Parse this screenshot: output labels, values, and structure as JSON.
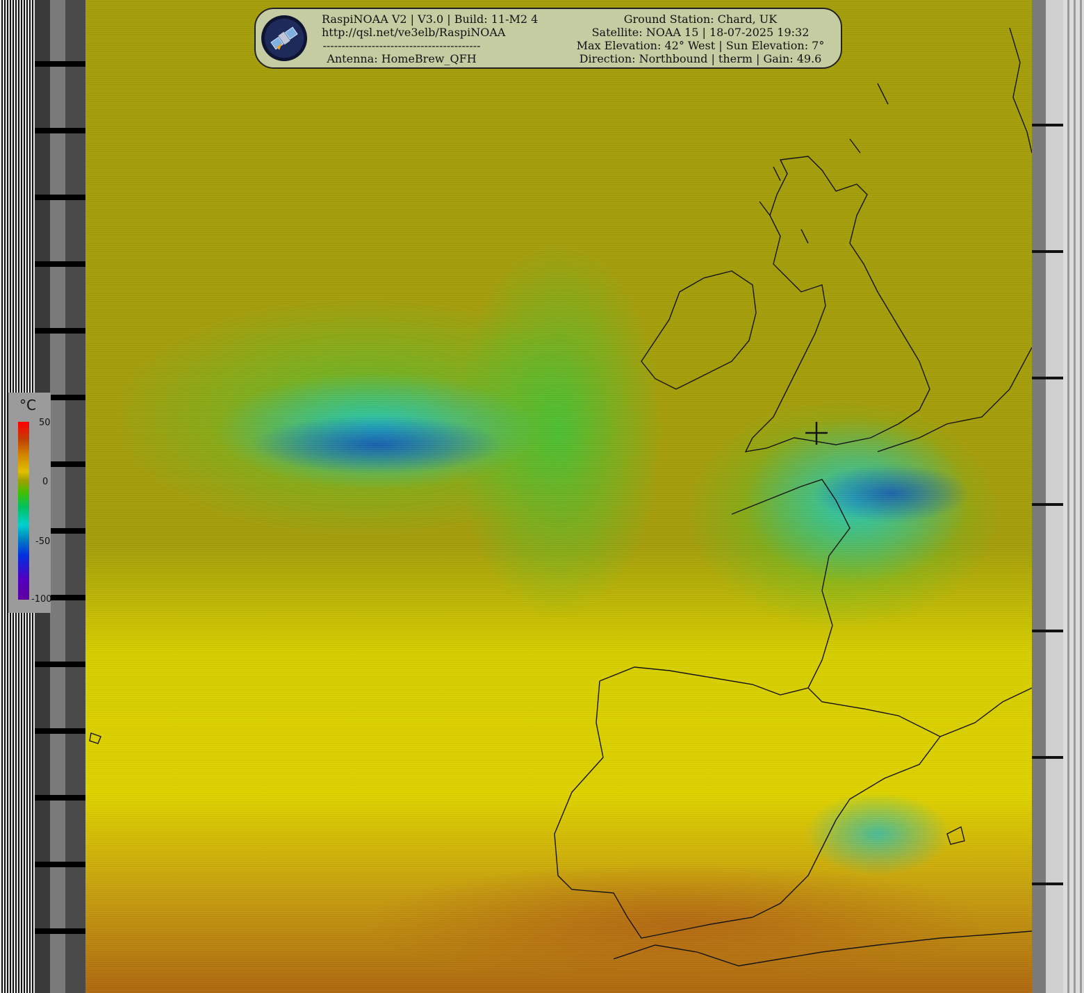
{
  "header": {
    "left_lines": [
      "RaspiNOAA V2 | V3.0 | Build: 11-M2 4",
      "http://qsl.net/ve3elb/RaspiNOAA",
      "------------------------------------------",
      "Antenna: HomeBrew_QFH"
    ],
    "right_lines": [
      "Ground Station: Chard, UK",
      "Satellite: NOAA 15 | 18-07-2025 19:32",
      "Max Elevation: 42° West | Sun Elevation: 7°",
      "Direction: Northbound | therm | Gain: 49.6"
    ],
    "logo_icon": "satellite-icon"
  },
  "legend": {
    "unit": "°C",
    "labels": [
      "50",
      "0",
      "-50",
      "-100"
    ],
    "colors": [
      "#ff0000",
      "#e0c000",
      "#40c000",
      "#00d0d0",
      "#0030e0",
      "#6000a0"
    ]
  },
  "map": {
    "ground_station_marker": "crosshair-icon"
  }
}
